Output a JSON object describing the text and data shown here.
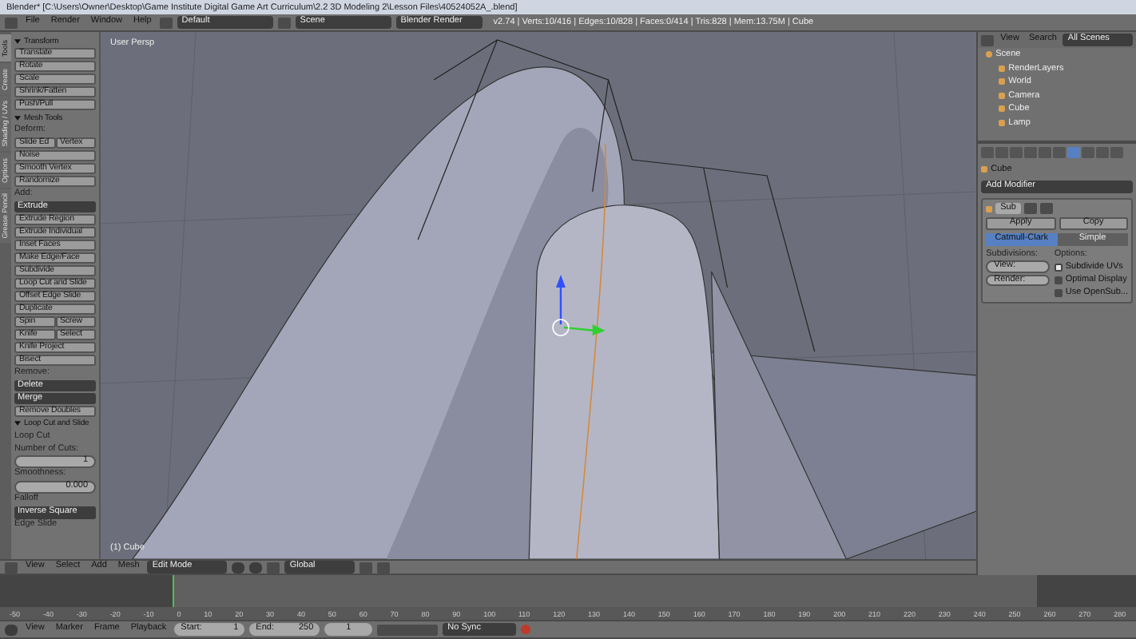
{
  "title_bar": {
    "title": "Blender* [C:\\Users\\Owner\\Desktop\\Game Institute Digital Game Art Curriculum\\2.2 3D Modeling 2\\Lesson Files\\40524052A_.blend]"
  },
  "info_header": {
    "menus": [
      "File",
      "Render",
      "Window",
      "Help"
    ],
    "layout": "Default",
    "scene": "Scene",
    "engine": "Blender Render",
    "stats": "v2.74 | Verts:10/416 | Edges:10/828 | Faces:0/414 | Tris:828 | Mem:13.75M | Cube"
  },
  "tool_tabs": [
    {
      "label": "Tools",
      "selected": true
    },
    {
      "label": "Create",
      "selected": false
    },
    {
      "label": "Shading / UVs",
      "selected": false
    },
    {
      "label": "Options",
      "selected": false
    },
    {
      "label": "Grease Pencil",
      "selected": false
    }
  ],
  "tool_panel": [
    {
      "kind": "header",
      "text": "Transform",
      "expanded": true
    },
    {
      "kind": "button",
      "text": "Translate"
    },
    {
      "kind": "button",
      "text": "Rotate"
    },
    {
      "kind": "button",
      "text": "Scale"
    },
    {
      "kind": "button",
      "text": "Shrink/Fatten"
    },
    {
      "kind": "button",
      "text": "Push/Pull"
    },
    {
      "kind": "header",
      "text": "Mesh Tools",
      "expanded": true
    },
    {
      "kind": "label",
      "text": "Deform:"
    },
    {
      "kind": "pair",
      "texts": [
        "Slide Ed",
        "Vertex"
      ]
    },
    {
      "kind": "button",
      "text": "Noise"
    },
    {
      "kind": "button",
      "text": "Smooth Vertex"
    },
    {
      "kind": "button",
      "text": "Randomize"
    },
    {
      "kind": "label",
      "text": "Add:"
    },
    {
      "kind": "dropdown",
      "text": "Extrude"
    },
    {
      "kind": "button",
      "text": "Extrude Region"
    },
    {
      "kind": "button",
      "text": "Extrude Individual"
    },
    {
      "kind": "button",
      "text": "Inset Faces"
    },
    {
      "kind": "button",
      "text": "Make Edge/Face"
    },
    {
      "kind": "button",
      "text": "Subdivide"
    },
    {
      "kind": "button",
      "text": "Loop Cut and Slide"
    },
    {
      "kind": "button",
      "text": "Offset Edge Slide"
    },
    {
      "kind": "button",
      "text": "Duplicate"
    },
    {
      "kind": "pair",
      "texts": [
        "Spin",
        "Screw"
      ]
    },
    {
      "kind": "pair",
      "texts": [
        "Knife",
        "Select"
      ]
    },
    {
      "kind": "button",
      "text": "Knife Project"
    },
    {
      "kind": "button",
      "text": "Bisect"
    },
    {
      "kind": "label",
      "text": "Remove:"
    },
    {
      "kind": "dropdown",
      "text": "Delete"
    },
    {
      "kind": "dropdown",
      "text": "Merge"
    },
    {
      "kind": "button",
      "text": "Remove Doubles"
    },
    {
      "kind": "header",
      "text": "Loop Cut and Slide",
      "expanded": true
    },
    {
      "kind": "label",
      "text": "Loop Cut"
    },
    {
      "kind": "label",
      "text": "Number of Cuts:"
    },
    {
      "kind": "field",
      "text": "1"
    },
    {
      "kind": "label",
      "text": "Smoothness:"
    },
    {
      "kind": "field",
      "text": "0.000"
    },
    {
      "kind": "label",
      "text": "Falloff"
    },
    {
      "kind": "dropdown",
      "text": "Inverse Square"
    },
    {
      "kind": "label",
      "text": "Edge Slide"
    }
  ],
  "viewport": {
    "view_label": "User Persp",
    "object_label": "(1) Cube"
  },
  "viewport_header": {
    "menus": [
      "View",
      "Select",
      "Add",
      "Mesh"
    ],
    "mode": "Edit Mode",
    "orientation": "Global"
  },
  "outliner": {
    "menus": [
      "View",
      "Search"
    ],
    "filter": "All Scenes",
    "tree": [
      {
        "label": "Scene",
        "children": [
          {
            "label": "RenderLayers"
          },
          {
            "label": "World"
          },
          {
            "label": "Camera"
          },
          {
            "label": "Cube"
          },
          {
            "label": "Lamp"
          }
        ]
      }
    ]
  },
  "properties": {
    "object": "Cube",
    "add_modifier": "Add Modifier",
    "modifier_name": "Sub",
    "apply": "Apply",
    "copy": "Copy",
    "methods": [
      {
        "label": "Catmull-Clark",
        "selected": true
      },
      {
        "label": "Simple",
        "selected": false
      }
    ],
    "subdivisions_label": "Subdivisions:",
    "subdivision_fields": [
      "View:",
      "Render:"
    ],
    "options_label": "Options:",
    "options": [
      {
        "label": "Subdivide UVs",
        "checked": true
      },
      {
        "label": "Optimal Display",
        "checked": false
      },
      {
        "label": "Use OpenSub...",
        "checked": false
      }
    ]
  },
  "timeline": {
    "ticks": [
      "-50",
      "-40",
      "-30",
      "-20",
      "-10",
      "0",
      "10",
      "20",
      "30",
      "40",
      "50",
      "60",
      "70",
      "80",
      "90",
      "100",
      "110",
      "120",
      "130",
      "140",
      "150",
      "160",
      "170",
      "180",
      "190",
      "200",
      "210",
      "220",
      "230",
      "240",
      "250",
      "260",
      "270",
      "280"
    ],
    "menus": [
      "View",
      "Marker",
      "Frame",
      "Playback"
    ],
    "start_label": "Start:",
    "start_value": "1",
    "end_label": "End:",
    "end_value": "250",
    "current": "1",
    "sync": "No Sync"
  }
}
